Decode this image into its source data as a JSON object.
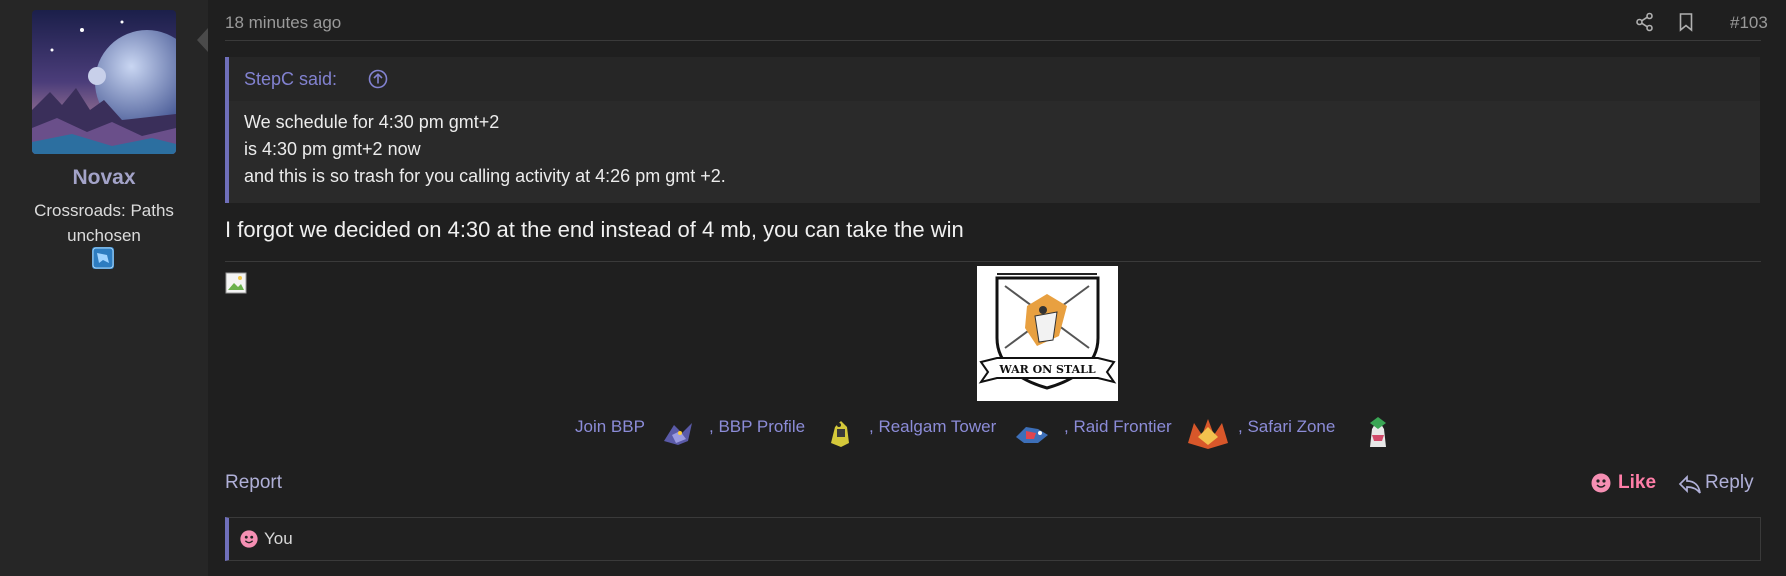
{
  "user": {
    "name": "Novax",
    "title": "Crossroads: Paths unchosen"
  },
  "post": {
    "time": "18 minutes ago",
    "number": "#103",
    "quote": {
      "author_label": "StepC said:",
      "lines": [
        "We schedule for 4:30 pm gmt+2",
        "is 4:30 pm gmt+2 now",
        "and this is so trash for you calling activity at 4:26 pm gmt +2."
      ]
    },
    "message": "I forgot we decided on 4:30 at the end instead of 4 mb, you can take the win",
    "signature": {
      "logo_text": "WAR ON STALL",
      "links": [
        "Join BBP",
        ", BBP Profile",
        ", Realgam Tower",
        ", Raid Frontier",
        ", Safari Zone"
      ]
    },
    "actions": {
      "report": "Report",
      "like": "Like",
      "reply": "Reply"
    },
    "likes_summary": "You"
  },
  "colors": {
    "accent": "#6f6fba",
    "like": "#ff7ea8",
    "link": "#8c8cd8"
  }
}
